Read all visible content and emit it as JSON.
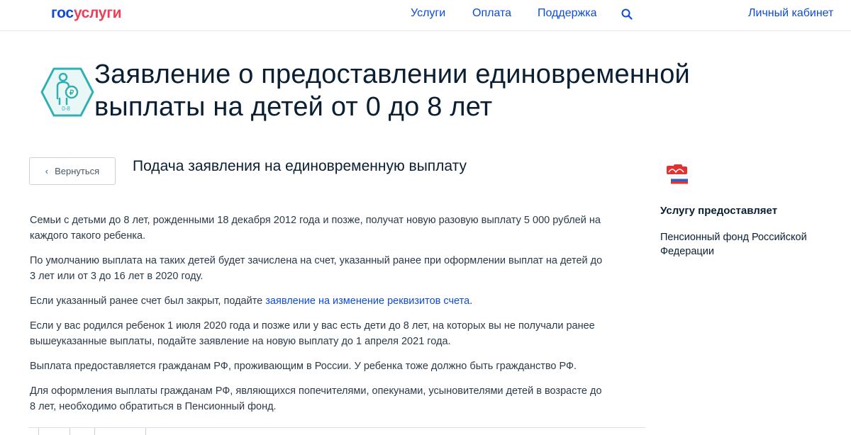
{
  "header": {
    "logo_part1": "гос",
    "logo_part2": "услуги",
    "nav": {
      "services": "Услуги",
      "payment": "Оплата",
      "support": "Поддержка",
      "account": "Личный кабинет"
    }
  },
  "service": {
    "title": "Заявление о предоставлении единовременной выплаты на детей от 0 до 8 лет",
    "icon_label": "0-8",
    "icon_currency": "₽"
  },
  "back_button": {
    "label": "Вернуться"
  },
  "section_title": "Подача заявления на единовременную выплату",
  "paragraphs": {
    "p1": "Семьи с детьми до 8 лет, рожденными 18 декабря 2012 года и позже, получат новую разовую выплату 5 000 рублей на каждого такого ребенка.",
    "p2": "По умолчанию выплата на таких детей будет зачислена на счет, указанный ранее при оформлении выплат на детей до 3 лет или от 3 до 16 лет в 2020 году.",
    "p3_prefix": "Если указанный ранее счет был закрыт, подайте ",
    "p3_link": "заявление на изменение реквизитов счета",
    "p3_suffix": ".",
    "p4": "Если у вас родился ребенок 1 июля 2020 года и позже или у вас есть дети до 8 лет, на которых вы не получали ранее вышеуказанные выплаты, подайте заявление на новую выплату до 1 апреля 2021 года.",
    "p5": "Выплата предоставляется гражданам РФ, проживающим в России. У ребенка тоже должно быть гражданство РФ.",
    "p6": "Для оформления выплаты гражданам РФ, являющихся попечителями, опекунами, усыновителями детей в возрасте до 8 лет, необходимо обратиться в Пенсионный фонд."
  },
  "provider": {
    "heading": "Услугу предоставляет",
    "name": "Пенсионный фонд Российской Федерации"
  },
  "colors": {
    "brand_blue": "#0d4cd3",
    "brand_red": "#ee3f58",
    "icon_teal": "#2fb0b3"
  }
}
